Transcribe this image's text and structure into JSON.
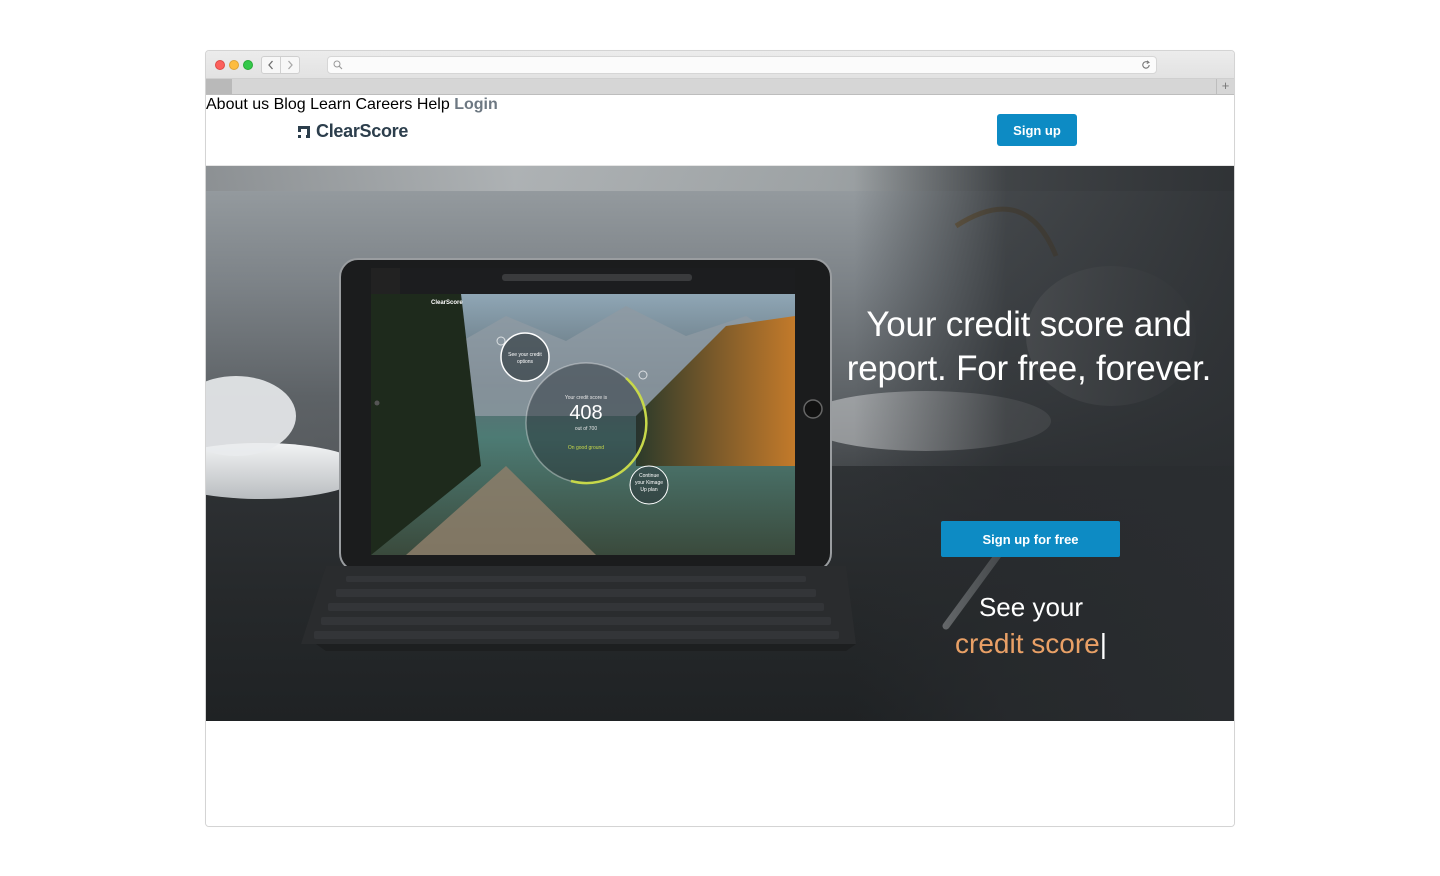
{
  "browser": {
    "controls": [
      "close",
      "minimize",
      "zoom"
    ],
    "back_icon": "chevron-left-icon",
    "forward_icon": "chevron-right-icon",
    "url_icon": "search-icon",
    "reload_icon": "reload-icon",
    "new_tab_label": "+"
  },
  "site": {
    "logo_text": "ClearScore",
    "nav": [
      "About us",
      "Blog",
      "Learn",
      "Careers",
      "Help"
    ],
    "signup_label": "Sign up",
    "login_label": "Login"
  },
  "hero": {
    "headline_line1": "Your credit score and",
    "headline_line2": "report. For free, forever.",
    "cta_label": "Sign up for free",
    "see_your": "See your",
    "typed_text": "credit score",
    "caret": "|"
  },
  "tablet_screen": {
    "logo_text": "ClearScore",
    "score_label": "Your credit score is",
    "score": "408",
    "score_max": "out of 700",
    "status": "On good ground",
    "bubble1": "See your credit options",
    "bubble2": "Continue your Kimage Up plan"
  },
  "colors": {
    "accent": "#0d8bc4",
    "typed_text": "#e9a066",
    "logo": "#2c3e4c",
    "nav_text": "#7c8792"
  }
}
